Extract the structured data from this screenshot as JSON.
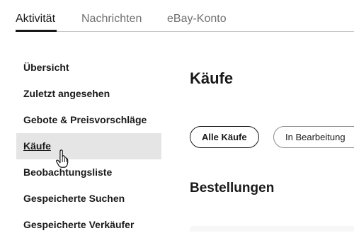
{
  "tabs": [
    {
      "label": "Aktivität",
      "active": true
    },
    {
      "label": "Nachrichten",
      "active": false
    },
    {
      "label": "eBay-Konto",
      "active": false
    }
  ],
  "sidebar": {
    "items": [
      {
        "label": "Übersicht"
      },
      {
        "label": "Zuletzt angesehen"
      },
      {
        "label": "Gebote & Preisvorschläge"
      },
      {
        "label": "Käufe",
        "selected": true
      },
      {
        "label": "Beobachtungsliste"
      },
      {
        "label": "Gespeicherte Suchen"
      },
      {
        "label": "Gespeicherte Verkäufer"
      }
    ]
  },
  "main": {
    "title": "Käufe",
    "filters": [
      {
        "label": "Alle Käufe",
        "active": true
      },
      {
        "label": "In Bearbeitung",
        "active": false
      }
    ],
    "section_heading": "Bestellungen"
  },
  "colors": {
    "text": "#191919",
    "muted": "#707070",
    "selected_bg": "#e5e5e5",
    "divider": "#c7c7c7"
  },
  "icons": {
    "cursor": "hand-pointer-icon"
  }
}
